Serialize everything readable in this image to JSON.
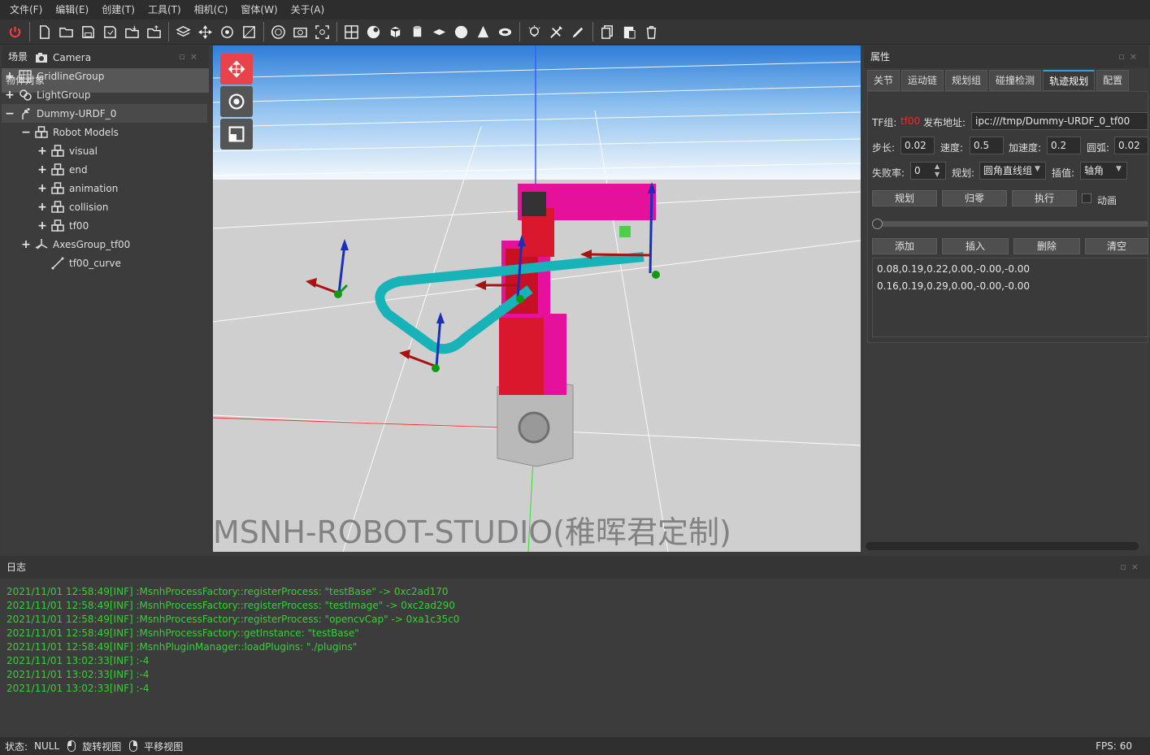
{
  "menu": [
    "文件(F)",
    "编辑(E)",
    "创建(T)",
    "工具(T)",
    "相机(C)",
    "窗体(W)",
    "关于(A)"
  ],
  "toolbar_icons": [
    "power-icon",
    "new-file-icon",
    "open-folder-icon",
    "save-icon",
    "save-as-icon",
    "import-icon",
    "export-icon",
    "layers-icon",
    "move-icon",
    "orbit-icon",
    "fit-icon",
    "target-icon",
    "camera-icon",
    "frame-icon",
    "grid-icon",
    "sphere-light-icon",
    "cube-icon",
    "cylinder-icon",
    "plane-icon",
    "sphere-icon",
    "cone-icon",
    "torus-icon",
    "light-bulb-icon",
    "tools-icon",
    "brush-icon",
    "copy-icon",
    "paste-icon",
    "delete-icon"
  ],
  "scene": {
    "title": "场景",
    "header": "物体对象",
    "items": [
      {
        "label": "Camera",
        "icon": "camera-icon",
        "expand": ""
      },
      {
        "label": "GridlineGroup",
        "icon": "grid-group-icon",
        "expand": "+"
      },
      {
        "label": "LightGroup",
        "icon": "light-group-icon",
        "expand": "+"
      },
      {
        "label": "Dummy-URDF_0",
        "icon": "urdf-icon",
        "expand": "−"
      },
      {
        "label": "Robot Models",
        "icon": "model-icon",
        "expand": "−"
      },
      {
        "label": "visual",
        "icon": "model-icon",
        "expand": "+"
      },
      {
        "label": "end",
        "icon": "model-icon",
        "expand": "+"
      },
      {
        "label": "animation",
        "icon": "model-icon",
        "expand": "+"
      },
      {
        "label": "collision",
        "icon": "model-icon",
        "expand": "+"
      },
      {
        "label": "tf00",
        "icon": "model-icon",
        "expand": "+"
      },
      {
        "label": "AxesGroup_tf00",
        "icon": "axes-icon",
        "expand": "+"
      },
      {
        "label": "tf00_curve",
        "icon": "curve-icon",
        "expand": ""
      }
    ]
  },
  "viewport": {
    "watermark": "MSNH-ROBOT-STUDIO(稚晖君定制)"
  },
  "props": {
    "title": "属性",
    "tabs": [
      "关节",
      "运动链",
      "规划组",
      "碰撞检测",
      "轨迹规划",
      "配置"
    ],
    "active_tab": "轨迹规划",
    "tf_label": "TF组:",
    "tf_value": "tf00",
    "addr_label": "发布地址:",
    "addr_value": "ipc:///tmp/Dummy-URDF_0_tf00",
    "step_label": "步长:",
    "step_value": "0.02",
    "speed_label": "速度:",
    "speed_value": "0.5",
    "accel_label": "加速度:",
    "accel_value": "0.2",
    "arc_label": "圆弧:",
    "arc_value": "0.02",
    "fail_label": "失败率:",
    "fail_value": "0",
    "plan_label": "规划:",
    "plan_value": "圆角直线组",
    "interp_label": "插值:",
    "interp_value": "轴角",
    "btn_plan": "规划",
    "btn_home": "归零",
    "btn_exec": "执行",
    "anim_label": "动画",
    "btn_add": "添加",
    "btn_insert": "插入",
    "btn_remove": "删除",
    "btn_clear": "清空",
    "points": [
      "0.08,0.19,0.22,0.00,-0.00,-0.00",
      "0.16,0.19,0.29,0.00,-0.00,-0.00"
    ]
  },
  "log": {
    "title": "日志",
    "lines": [
      "2021/11/01 12:58:49[INF] :MsnhProcessFactory::registerProcess: \"testBase\" -> 0xc2ad170",
      "2021/11/01 12:58:49[INF] :MsnhProcessFactory::registerProcess: \"testImage\" -> 0xc2ad290",
      "2021/11/01 12:58:49[INF] :MsnhProcessFactory::registerProcess: \"opencvCap\" -> 0xa1c35c0",
      "2021/11/01 12:58:49[INF] :MsnhProcessFactory::getInstance: \"testBase\"",
      "2021/11/01 12:58:49[INF] :MsnhPluginManager::loadPlugins: \"./plugins\"",
      "2021/11/01 13:02:33[INF] :-4",
      "2021/11/01 13:02:33[INF] :-4",
      "2021/11/01 13:02:33[INF] :-4"
    ]
  },
  "status": {
    "label": "状态:",
    "value": "NULL",
    "rotate": "旋转视图",
    "pan": "平移视图",
    "fps": "FPS: 60"
  },
  "colors": {
    "log_text": "#35d035",
    "accent": "#2e9fe0",
    "tf_red": "#e03030"
  }
}
